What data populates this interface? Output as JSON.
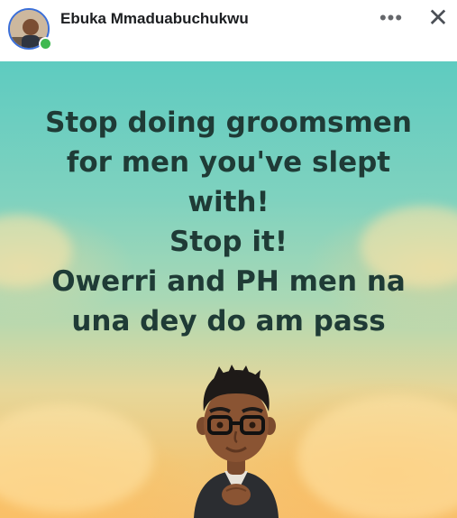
{
  "header": {
    "author_name": "Ebuka Mmaduabuchukwu",
    "more_icon": "more-horizontal-icon",
    "more_glyph": "•••",
    "close_icon": "close-icon",
    "close_glyph": "✕",
    "online_status": "online",
    "online_color": "#3fb950"
  },
  "post": {
    "text_lines": [
      "Stop doing groomsmen",
      "for men you've slept",
      "with!",
      "Stop it!",
      "Owerri and PH men na",
      "una dey do am pass"
    ],
    "text_color": "#1f3b36"
  }
}
